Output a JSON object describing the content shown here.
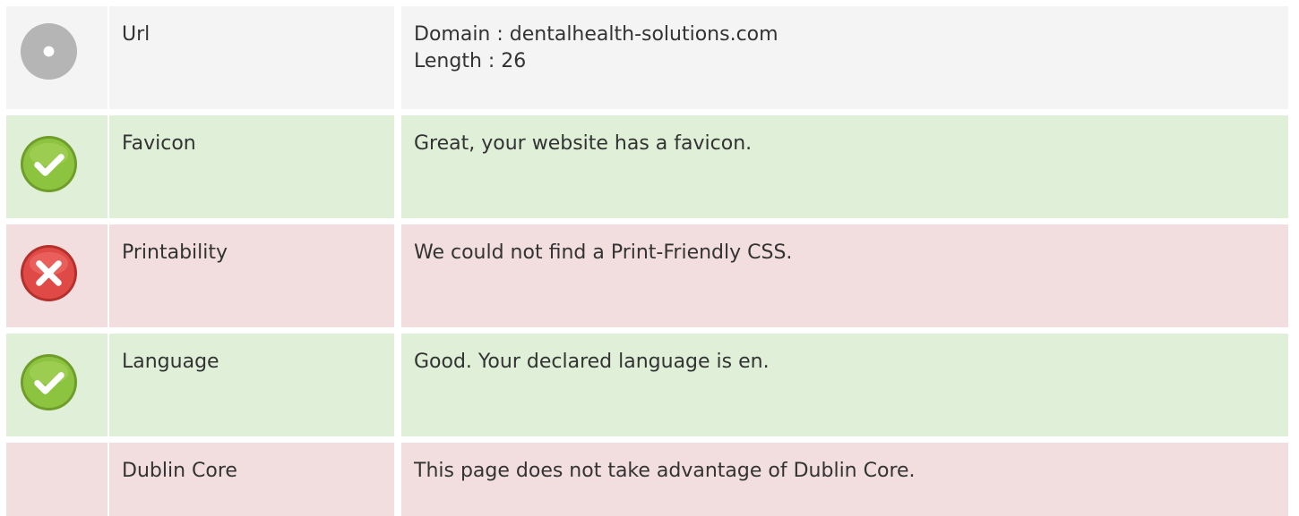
{
  "rows": [
    {
      "status": "neutral",
      "icon": "gray-dot-icon",
      "label": "Url",
      "lines": [
        "Domain : dentalhealth-solutions.com",
        "Length : 26"
      ]
    },
    {
      "status": "pass",
      "icon": "check-icon",
      "label": "Favicon",
      "lines": [
        "Great, your website has a favicon."
      ]
    },
    {
      "status": "fail",
      "icon": "error-x-icon",
      "label": "Printability",
      "lines": [
        "We could not find a Print-Friendly CSS."
      ]
    },
    {
      "status": "pass",
      "icon": "check-icon",
      "label": "Language",
      "lines": [
        "Good. Your declared language is en."
      ]
    },
    {
      "status": "fail",
      "icon": "",
      "label": "Dublin Core",
      "lines": [
        "This page does not take advantage of Dublin Core."
      ]
    }
  ],
  "colors": {
    "neutral_bg": "#f4f4f4",
    "pass_bg": "#dfefd8",
    "fail_bg": "#f2dede",
    "pass_icon": "#8cc43f",
    "fail_icon": "#e04a46",
    "neutral_icon": "#b5b5b5"
  }
}
